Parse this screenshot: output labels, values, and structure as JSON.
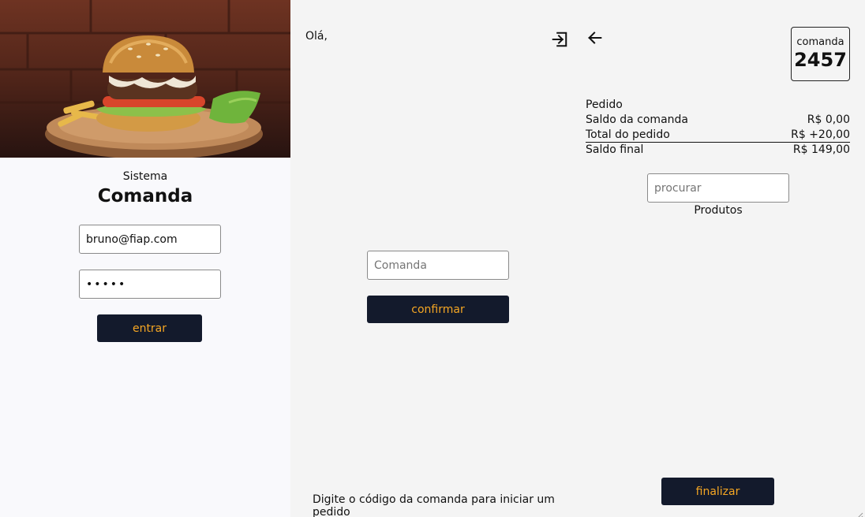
{
  "login": {
    "system_label": "Sistema",
    "app_title": "Comanda",
    "email_value": "bruno@fiap.com",
    "password_value": "•••••",
    "submit_label": "entrar"
  },
  "comanda_screen": {
    "greeting": "Olá,",
    "logout_icon": "logout-icon",
    "input_placeholder": "Comanda",
    "confirm_label": "confirmar",
    "hint": "Digite o código da comanda para iniciar um pedido"
  },
  "order_screen": {
    "back_icon": "arrow-left-icon",
    "badge_label": "comanda",
    "badge_number": "2457",
    "summary_title": "Pedido",
    "rows": [
      {
        "label": "Saldo da comanda",
        "value": "R$ 0,00"
      },
      {
        "label": "Total do pedido",
        "value": "R$ +20,00"
      },
      {
        "label": "Saldo final",
        "value": "R$ 149,00"
      }
    ],
    "search_placeholder": "procurar",
    "products_label": "Produtos",
    "finish_label": "finalizar"
  },
  "colors": {
    "button_bg": "#131a2c",
    "button_text": "#f5a623",
    "panel_bg": "#f4f4f4",
    "login_bg": "#f9f9fc"
  }
}
